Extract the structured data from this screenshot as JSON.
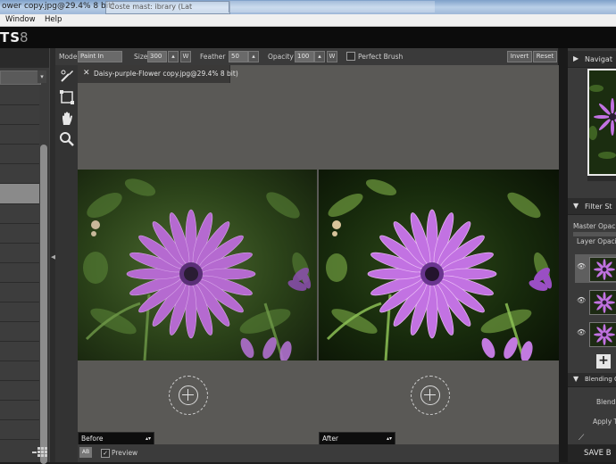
{
  "window": {
    "title": "ower copy.jpg@29.4% 8 bit)",
    "inactive_tab": "Coste mast: ibrary (Lat"
  },
  "menu": {
    "items": [
      "Window",
      "Help"
    ]
  },
  "brand": {
    "logo": "TS",
    "version": "8"
  },
  "toolbar": {
    "mode_label": "Mode",
    "mode_value": "Paint In",
    "size_label": "Size",
    "size_value": "300",
    "size_btn": "W",
    "feather_label": "Feather",
    "feather_value": "50",
    "opacity_label": "Opacity",
    "opacity_value": "100",
    "opacity_btn": "W",
    "perfect_brush_label": "Perfect Brush",
    "invert_label": "Invert",
    "reset_label": "Reset"
  },
  "document": {
    "tab_close": "✕",
    "tab_name": "Daisy-purple-Flower copy.jpg@29.4% 8 bit)"
  },
  "views": {
    "before_label": "Before",
    "after_label": "After"
  },
  "bottom": {
    "ab_label": "AB",
    "preview_checked": true,
    "preview_label": "Preview"
  },
  "right_panel": {
    "navigator_title": "Navigat",
    "filter_stack_title": "Filter St",
    "master_opacity_label": "Master Opaci",
    "layer_opacity_label": "Layer Opaci",
    "blending_options_title": "Blending Op",
    "blend_label": "Blendi",
    "apply_label": "Apply T",
    "save_label": "SAVE B"
  },
  "colors": {
    "accent_ui": "#3a3a3a",
    "petal": "#b56ad0",
    "flower_center": "#3a2a4a",
    "foliage": "#2e4a1c"
  }
}
